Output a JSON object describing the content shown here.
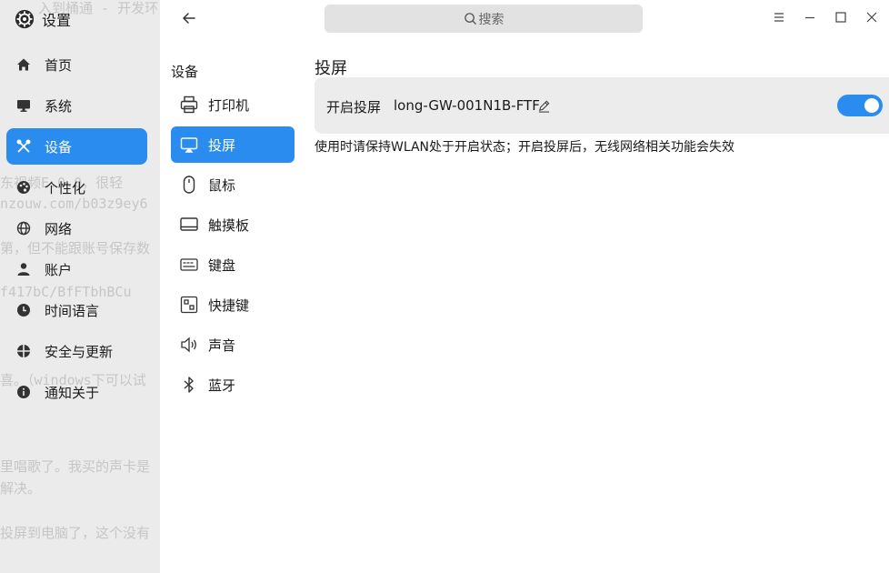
{
  "app": {
    "title": "设置"
  },
  "search": {
    "placeholder": "搜索"
  },
  "sidebar": {
    "items": [
      {
        "label": "首页",
        "icon": "home-icon"
      },
      {
        "label": "系统",
        "icon": "monitor-icon"
      },
      {
        "label": "设备",
        "icon": "tools-icon",
        "active": true
      },
      {
        "label": "个性化",
        "icon": "palette-icon"
      },
      {
        "label": "网络",
        "icon": "globe-icon"
      },
      {
        "label": "账户",
        "icon": "user-icon"
      },
      {
        "label": "时间语言",
        "icon": "clock-icon"
      },
      {
        "label": "安全与更新",
        "icon": "shield-icon"
      },
      {
        "label": "通知关于",
        "icon": "info-icon"
      }
    ]
  },
  "background_text": [
    "入到桶通 - 开发环",
    "东视频E.0.0，很轻",
    "nzouw.com/b03z9ey6",
    "第，但不能跟账号保存数",
    "f417bC/BfFTbhBCu",
    "喜。（windows下可以试",
    "里唱歌了。我买的声卡是",
    "解决。",
    "投屏到电脑了，这个没有"
  ],
  "devices": {
    "title": "设备",
    "items": [
      {
        "label": "打印机",
        "icon": "printer-icon"
      },
      {
        "label": "投屏",
        "icon": "cast-screen-icon",
        "active": true
      },
      {
        "label": "鼠标",
        "icon": "mouse-icon"
      },
      {
        "label": "触摸板",
        "icon": "touchpad-icon"
      },
      {
        "label": "键盘",
        "icon": "keyboard-icon"
      },
      {
        "label": "快捷键",
        "icon": "shortcut-icon"
      },
      {
        "label": "声音",
        "icon": "speaker-icon"
      },
      {
        "label": "蓝牙",
        "icon": "bluetooth-icon"
      }
    ]
  },
  "projection": {
    "title": "投屏",
    "enable_label": "开启投屏",
    "device_name": "long-GW-001N1B-FTF",
    "enabled": true,
    "hint": "使用时请保持WLAN处于开启状态；开启投屏后，无线网络相关功能会失效"
  },
  "colors": {
    "accent": "#2b8cf0"
  }
}
